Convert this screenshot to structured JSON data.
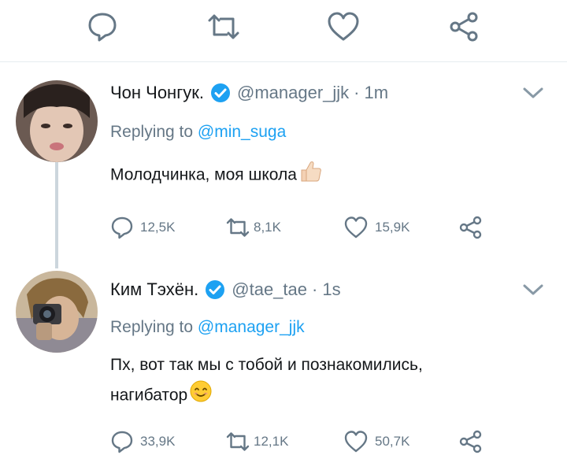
{
  "colors": {
    "accent": "#1da1f2",
    "icon": "#657786",
    "text": "#14171a",
    "divider": "#e6ecf0"
  },
  "top_actions": [
    "reply-icon",
    "retweet-icon",
    "like-icon",
    "share-icon"
  ],
  "tweets": [
    {
      "name": "Чон Чонгук.",
      "handle": "@manager_jjk",
      "sep": "·",
      "time": "1m",
      "reply_prefix": "Replying to ",
      "reply_to": "@min_suga",
      "text": "Молодчинка, моя школа",
      "emoji": "thumbs-up-icon",
      "replies": "12,5K",
      "retweets": "8,1K",
      "likes": "15,9K"
    },
    {
      "name": "Ким Тэхён.",
      "handle": "@tae_tae",
      "sep": "·",
      "time": "1s",
      "reply_prefix": "Replying to ",
      "reply_to": "@manager_jjk",
      "text_line1": "Пх, вот так мы с тобой и познакомились,",
      "text_line2": "нагибатор",
      "emoji": "smiling-face-icon",
      "replies": "33,9K",
      "retweets": "12,1K",
      "likes": "50,7K"
    }
  ]
}
